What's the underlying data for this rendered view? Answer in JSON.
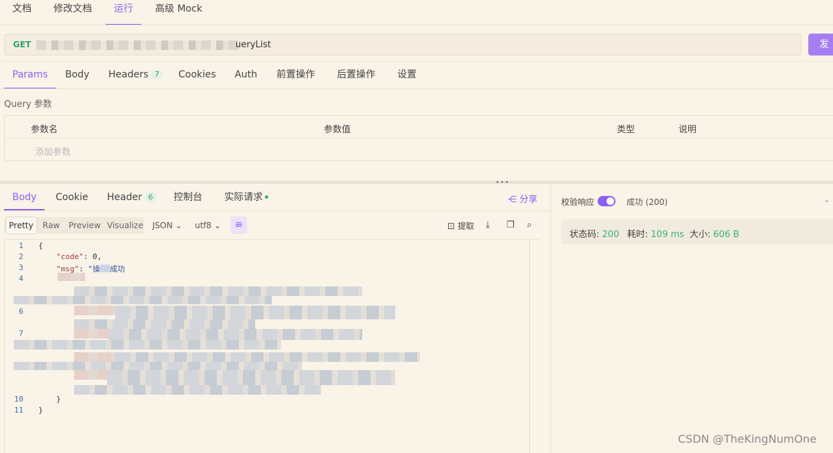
{
  "top_tabs": [
    "文档",
    "修改文档",
    "运行",
    "高级 Mock"
  ],
  "request": {
    "method": "GET",
    "url_visible_tail": "ueryList",
    "send_label": "发"
  },
  "param_tabs": {
    "params": "Params",
    "body": "Body",
    "headers": "Headers",
    "headers_count": "7",
    "cookies": "Cookies",
    "auth": "Auth",
    "pre": "前置操作",
    "post": "后置操作",
    "settings": "设置"
  },
  "query": {
    "label": "Query 参数",
    "columns": [
      "参数名",
      "参数值",
      "类型",
      "说明"
    ],
    "add_placeholder": "添加参数"
  },
  "response_tabs": {
    "body": "Body",
    "cookie": "Cookie",
    "header": "Header",
    "header_count": "6",
    "console": "控制台",
    "actual": "实际请求",
    "share": "分享"
  },
  "toolbar": {
    "views": [
      "Pretty",
      "Raw",
      "Preview",
      "Visualize"
    ],
    "format": "JSON",
    "encoding": "utf8",
    "extract": "提取"
  },
  "code": {
    "line_numbers": [
      "1",
      "2",
      "3",
      "4",
      "6",
      "7",
      "10",
      "11"
    ],
    "line1": "{",
    "code_key": "\"code\"",
    "code_val": "0,",
    "msg_key": "\"msg\"",
    "msg_val_start": "\"操",
    "msg_val_end": "成功",
    "line10": "}",
    "line11": "}"
  },
  "right_panel": {
    "verify_label": "校验响应",
    "result": "成功 (200)",
    "status_label": "状态码:",
    "status_value": "200",
    "time_label": "耗时:",
    "time_value": "109 ms",
    "size_label": "大小:",
    "size_value": "606 B"
  },
  "watermark": "CSDN @TheKingNumOne",
  "colors": {
    "accent": "#8a5ff0",
    "success": "#3ab26e",
    "background": "#f9f3e8"
  }
}
